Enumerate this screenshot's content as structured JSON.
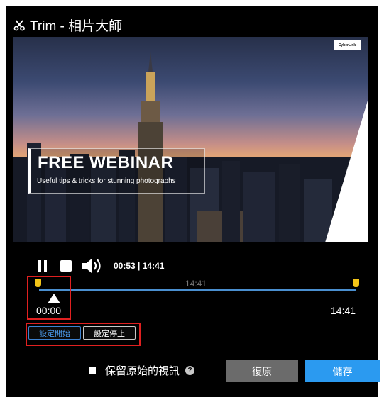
{
  "window": {
    "title": "Trim - 相片大師"
  },
  "video": {
    "brand_logo": "CyberLink",
    "heading": "FREE WEBINAR",
    "subheading": "Useful tips & tricks for stunning photographs"
  },
  "player": {
    "current_time": "00:53",
    "separator": " | ",
    "total_time": "14:41",
    "timeline_time": "14:41",
    "start_label": "00:00",
    "end_label": "14:41"
  },
  "trim_buttons": {
    "set_start": "設定開始",
    "set_end": "設定停止"
  },
  "footer": {
    "keep_original_label": "保留原始的視訊",
    "help_glyph": "?",
    "reset_label": "復原",
    "save_label": "儲存"
  },
  "colors": {
    "accent": "#2b9af0",
    "handle": "#f4c518",
    "highlight": "#e02020"
  }
}
